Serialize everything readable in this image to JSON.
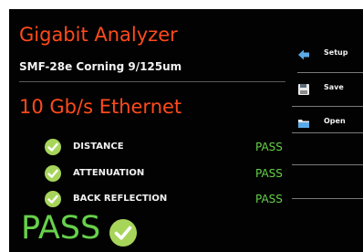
{
  "header": {
    "title": "Gigabit Analyzer",
    "fiber_type": "SMF-28e Corning 9/125um",
    "mode": "10 Gb/s Ethernet"
  },
  "tests": [
    {
      "label": "DISTANCE",
      "result": "PASS",
      "icon": "check-circle-icon"
    },
    {
      "label": "ATTENUATION",
      "result": "PASS",
      "icon": "check-circle-icon"
    },
    {
      "label": "BACK REFLECTION",
      "result": "PASS",
      "icon": "check-circle-icon"
    }
  ],
  "overall": {
    "result": "PASS",
    "icon": "check-circle-icon"
  },
  "sidebar": {
    "buttons": [
      {
        "label": "Setup",
        "icon": "arrow-left-icon"
      },
      {
        "label": "Save",
        "icon": "floppy-disk-icon"
      },
      {
        "label": "Open",
        "icon": "folder-icon"
      }
    ]
  },
  "colors": {
    "background": "#020202",
    "title": "#ff4a1c",
    "pass": "#66d14a",
    "check": "#a7d55a",
    "icon_blue": "#5aa9e6"
  }
}
